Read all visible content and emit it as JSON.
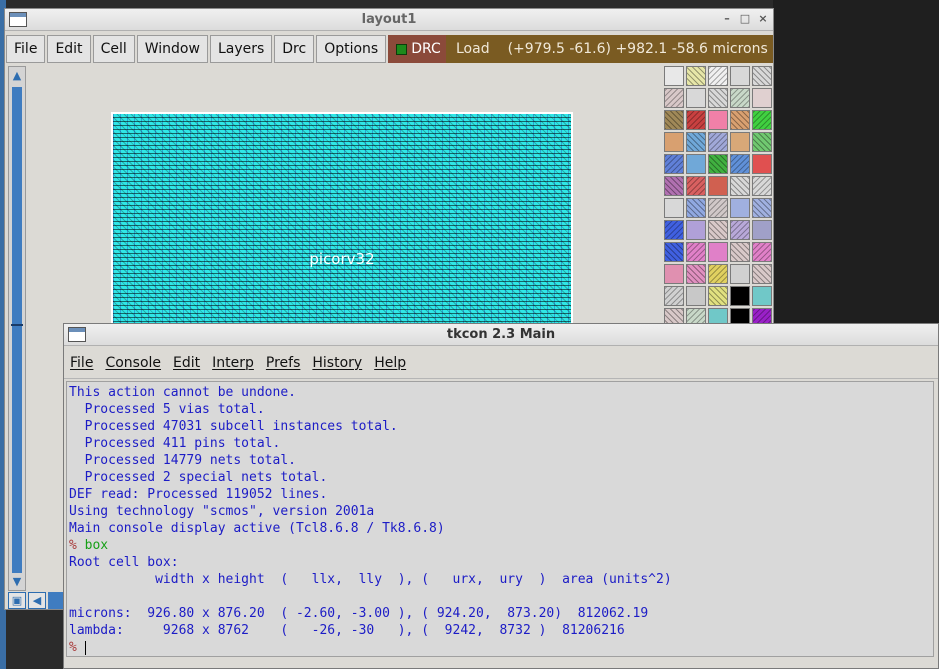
{
  "layout_window": {
    "title": "layout1",
    "controls": {
      "minimize": "–",
      "maximize": "□",
      "close": "×"
    },
    "menu": [
      "File",
      "Edit",
      "Cell",
      "Window",
      "Layers",
      "Drc",
      "Options"
    ],
    "drc_label": "DRC",
    "status_left": "Load",
    "status_coords": "(+979.5 -61.6) +982.1 -58.6 microns",
    "cell_label": "picorv32",
    "palette_colors": [
      "#e8e8e8",
      "#e6e6a8",
      "#f0f0f0",
      "#d8d8d8",
      "#d8d8d8",
      "#d8c8c8",
      "#d8d8d8",
      "#d8d8d8",
      "#c8d8c8",
      "#e0d0d0",
      "#a08858",
      "#c84040",
      "#f080a8",
      "#d8a070",
      "#40d040",
      "#d8a070",
      "#70a8d8",
      "#a0a8d8",
      "#d8a878",
      "#70c870",
      "#6080d8",
      "#70a8d8",
      "#40b040",
      "#6090d8",
      "#e05050",
      "#b070b0",
      "#d86060",
      "#d06050",
      "#d8d8d8",
      "#d8d8d8",
      "#d8d8d8",
      "#90a8e0",
      "#d0c8c8",
      "#a0b0e0",
      "#a0b0e0",
      "#4060e0",
      "#b0a0d8",
      "#d8c8c8",
      "#b8a8d8",
      "#a0a0c8",
      "#4060e0",
      "#e080c8",
      "#e080c8",
      "#d8c8c8",
      "#e080c8",
      "#e090b0",
      "#e090c0",
      "#e0d060",
      "#d0d0d0",
      "#d8c8c8",
      "#d0d0d0",
      "#c8c8c8",
      "#e0e080",
      "#000000",
      "#70c8c8",
      "#d8c8c8",
      "#c8d8c8",
      "#70c8c8",
      "#000000",
      "#9a20c8"
    ]
  },
  "tk_window": {
    "title": "tkcon 2.3 Main",
    "menu": [
      "File",
      "Console",
      "Edit",
      "Interp",
      "Prefs",
      "History",
      "Help"
    ],
    "console_lines": [
      "This action cannot be undone.",
      "  Processed 5 vias total.",
      "  Processed 47031 subcell instances total.",
      "  Processed 411 pins total.",
      "  Processed 14779 nets total.",
      "  Processed 2 special nets total.",
      "DEF read: Processed 119052 lines.",
      "Using technology \"scmos\", version 2001a",
      "Main console display active (Tcl8.6.8 / Tk8.6.8)"
    ],
    "prompt": "%",
    "command": "box",
    "output_lines": [
      "Root cell box:",
      "           width x height  (   llx,  lly  ), (   urx,  ury  )  area (units^2)",
      "",
      "microns:  926.80 x 876.20  ( -2.60, -3.00 ), ( 924.20,  873.20)  812062.19",
      "lambda:     9268 x 8762    (   -26, -30   ), (  9242,  8732 )  81206216"
    ]
  }
}
